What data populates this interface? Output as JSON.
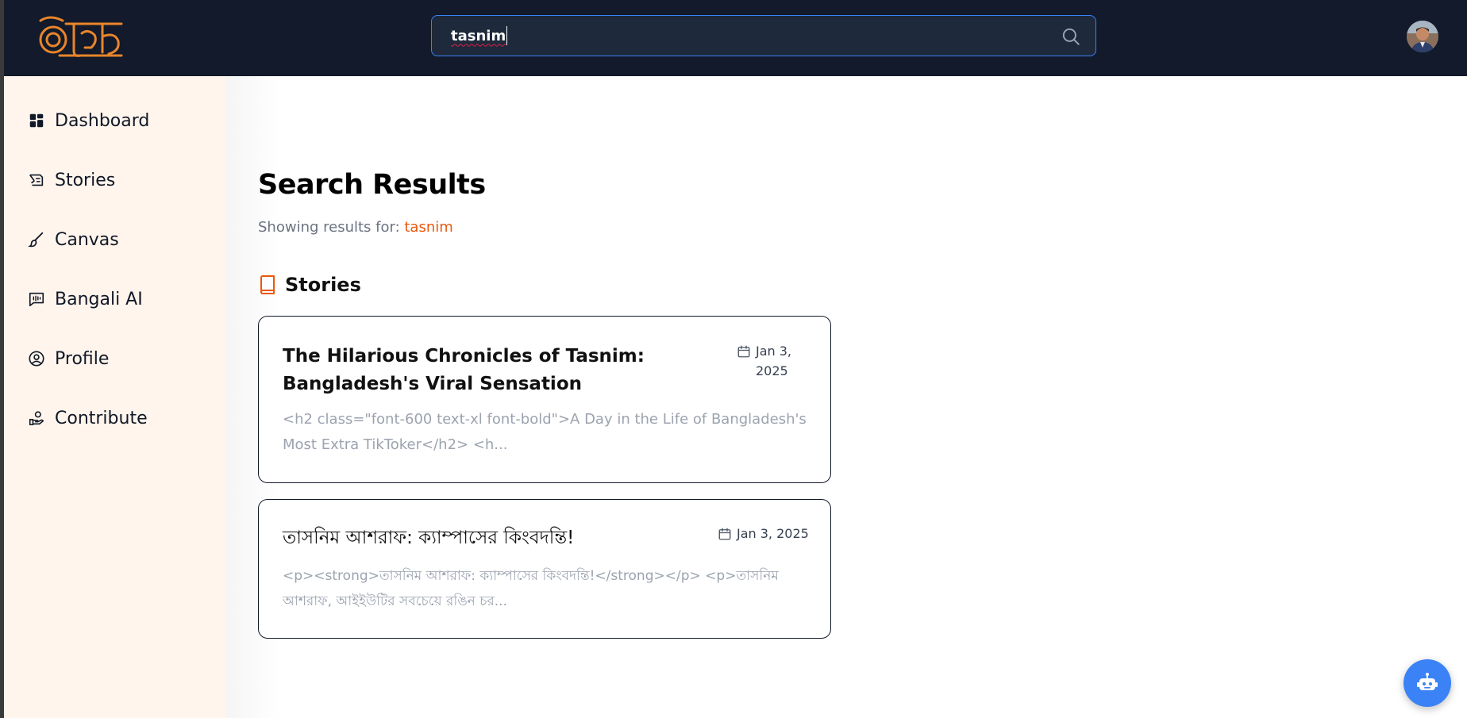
{
  "app": {
    "logo_text": "অক্ষর"
  },
  "search": {
    "value": "tasnim"
  },
  "sidebar": {
    "items": [
      {
        "label": "Dashboard",
        "icon": "dashboard-icon"
      },
      {
        "label": "Stories",
        "icon": "stories-icon"
      },
      {
        "label": "Canvas",
        "icon": "brush-icon"
      },
      {
        "label": "Bangali AI",
        "icon": "ai-chat-icon"
      },
      {
        "label": "Profile",
        "icon": "user-circle-icon"
      },
      {
        "label": "Contribute",
        "icon": "contribute-icon"
      }
    ]
  },
  "main": {
    "title": "Search Results",
    "results_prefix": "Showing results for: ",
    "query": "tasnim",
    "section_title": "Stories"
  },
  "results": [
    {
      "title": "The Hilarious Chronicles of Tasnim: Bangladesh's Viral Sensation",
      "date": "Jan 3, 2025",
      "excerpt": "<h2 class=\"font-600 text-xl font-bold\">A Day in the Life of Bangladesh's Most Extra TikToker</h2> <h..."
    },
    {
      "title": "তাসনিম আশরাফ: ক্যাম্পাসের কিংবদন্তি!",
      "date": "Jan 3, 2025",
      "excerpt": "<p><strong>তাসনিম আশরাফ: ক্যাম্পাসের কিংবদন্তি!</strong></p> <p>তাসনিম আশরাফ, আইইউটির সবচেয়ে রঙিন চর..."
    }
  ],
  "colors": {
    "topbar": "#121a2b",
    "sidebar": "#fff5ec",
    "accent": "#ea580c",
    "search_border": "#3b82f6",
    "bot_button": "#3b82f6"
  }
}
